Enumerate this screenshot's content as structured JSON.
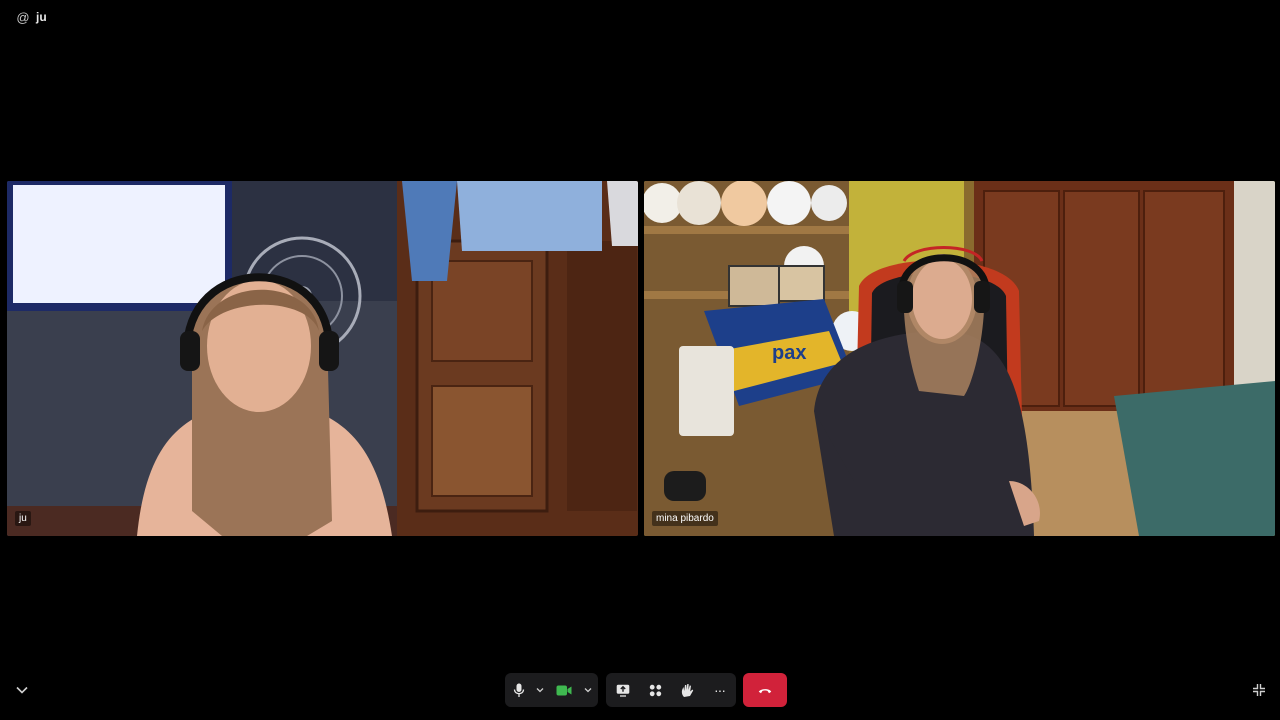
{
  "window": {
    "title": "ju",
    "title_icon": "at-sign-icon"
  },
  "participants": [
    {
      "name": "ju",
      "active_speaker": false
    },
    {
      "name": "mina pibardo",
      "active_speaker": true
    }
  ],
  "toolbar": {
    "mic": {
      "icon": "microphone-icon",
      "state": "on"
    },
    "camera": {
      "icon": "video-camera-icon",
      "state": "on",
      "color": "#3fb950"
    },
    "share": {
      "icon": "share-screen-icon"
    },
    "apps": {
      "icon": "apps-icon"
    },
    "reactions": {
      "icon": "raise-hand-icon"
    },
    "more": {
      "icon": "more-icon",
      "label": "···"
    },
    "end_call": {
      "icon": "hang-up-icon",
      "color": "#d1223a"
    }
  },
  "corners": {
    "bottom_left": "chevron-down-icon",
    "bottom_right": "exit-fullscreen-icon"
  },
  "colors": {
    "background": "#000000",
    "active_border": "#3fb950",
    "toolbar_bg": "#1c1c1e"
  }
}
